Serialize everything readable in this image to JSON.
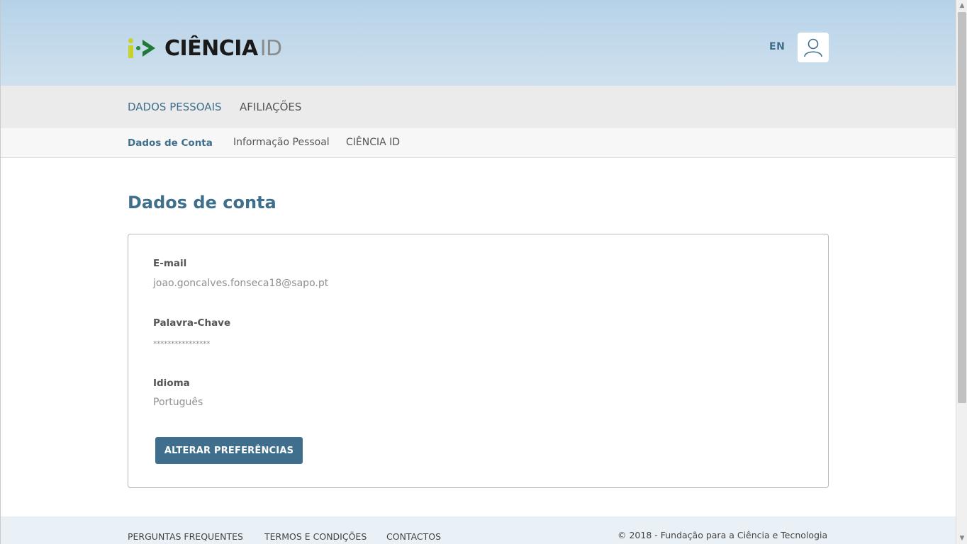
{
  "header": {
    "logo_text": "CIÊNCIA",
    "logo_suffix": "ID",
    "lang_label": "EN"
  },
  "main_nav": {
    "items": [
      {
        "label": "DADOS PESSOAIS"
      },
      {
        "label": "AFILIAÇÕES"
      }
    ]
  },
  "sub_nav": {
    "items": [
      {
        "label": "Dados de Conta",
        "active": true
      },
      {
        "label": "Informação Pessoal"
      },
      {
        "label": "CIÊNCIA ID"
      }
    ]
  },
  "content": {
    "title": "Dados de conta",
    "fields": [
      {
        "label": "E-mail",
        "value": "joao.goncalves.fonseca18@sapo.pt"
      },
      {
        "label": "Palavra-Chave",
        "value": "****************"
      },
      {
        "label": "Idioma",
        "value": "Português"
      }
    ],
    "button_label": "ALTERAR PREFERÊNCIAS"
  },
  "footer": {
    "links": [
      {
        "label": "PERGUNTAS FREQUENTES"
      },
      {
        "label": "TERMOS E CONDIÇÕES"
      },
      {
        "label": "CONTACTOS"
      }
    ],
    "copyright": "© 2018 - Fundação para a Ciência e Tecnologia"
  },
  "colors": {
    "accent": "#3f6f8c",
    "logo_yellow": "#c7d22b",
    "logo_green": "#2a8a3f",
    "header_bg": "#b6d2e8"
  },
  "icons": {
    "user": "user-icon",
    "logo": "ciencia-id-logo-icon"
  }
}
